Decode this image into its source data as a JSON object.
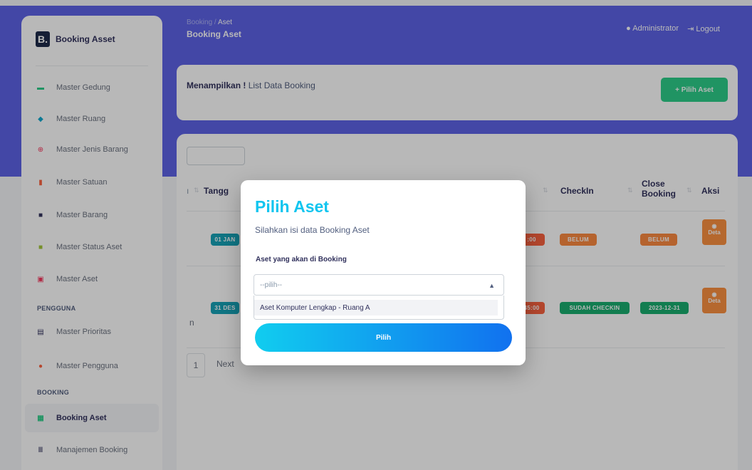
{
  "app": {
    "brand_letter": "B.",
    "brand_name": "Booking Asset"
  },
  "sidebar": {
    "items": [
      {
        "label": "Master Gedung",
        "icon": "card-icon",
        "color": "#2dce89"
      },
      {
        "label": "Master Ruang",
        "icon": "cube-icon",
        "color": "#11a8cd"
      },
      {
        "label": "Master Jenis Barang",
        "icon": "globe-icon",
        "color": "#f5365c"
      },
      {
        "label": "Master Satuan",
        "icon": "bar-chart-icon",
        "color": "#fb6340"
      },
      {
        "label": "Master Barang",
        "icon": "folder-icon",
        "color": "#32325d"
      },
      {
        "label": "Master Status Aset",
        "icon": "shopping-bag-icon",
        "color": "#a4c639"
      },
      {
        "label": "Master Aset",
        "icon": "screen-icon",
        "color": "#f5365c"
      }
    ],
    "heading_pengguna": "PENGGUNA",
    "pengguna_items": [
      {
        "label": "Master Prioritas",
        "icon": "book-icon",
        "color": "#32325d"
      },
      {
        "label": "Master Pengguna",
        "icon": "user-icon",
        "color": "#fb6340"
      }
    ],
    "heading_booking": "BOOKING",
    "booking_items": [
      {
        "label": "Booking Aset",
        "icon": "building-icon",
        "color": "#2dce89"
      },
      {
        "label": "Manajemen Booking",
        "icon": "library-icon",
        "color": "#32325d"
      }
    ]
  },
  "header": {
    "breadcrumb_root": "Booking",
    "breadcrumb_sep": "/",
    "breadcrumb_current": "Aset",
    "title": "Booking Aset",
    "user_label": "Administrator",
    "logout_label": "Logout"
  },
  "panel": {
    "lead": "Menampilkan !",
    "text": "List Data Booking",
    "add_button": "+ Pilih Aset"
  },
  "table": {
    "headers": {
      "tanggal": "Tangg",
      "checkin": "CheckIn",
      "close_booking_1": "Close",
      "close_booking_2": "Booking",
      "aksi": "Aksi",
      "left_marker": "ı"
    },
    "rows": [
      {
        "date_badge": "01 JAN",
        "time_badge": ":00",
        "checkin": "BELUM",
        "close": "BELUM",
        "aksi": "Deta"
      },
      {
        "date_badge": "31 DES",
        "time_badge": "45:00",
        "checkin": "SUDAH CHECKIN",
        "close": "2023-12-31",
        "aksi": "Deta"
      }
    ],
    "info_fragment": "n",
    "page_number": "1",
    "next_label": "Next"
  },
  "modal": {
    "title": "Pilih Aset",
    "subtitle": "Silahkan isi data Booking Aset",
    "field_label": "Aset yang akan di Booking",
    "select_value": "--pilih--",
    "options": [
      "Aset Komputer Lengkap - Ruang A"
    ],
    "submit_label": "Pilih"
  },
  "colors": {
    "primary": "#5e63e6",
    "accent": "#11c5ef",
    "success": "#2dce89"
  }
}
